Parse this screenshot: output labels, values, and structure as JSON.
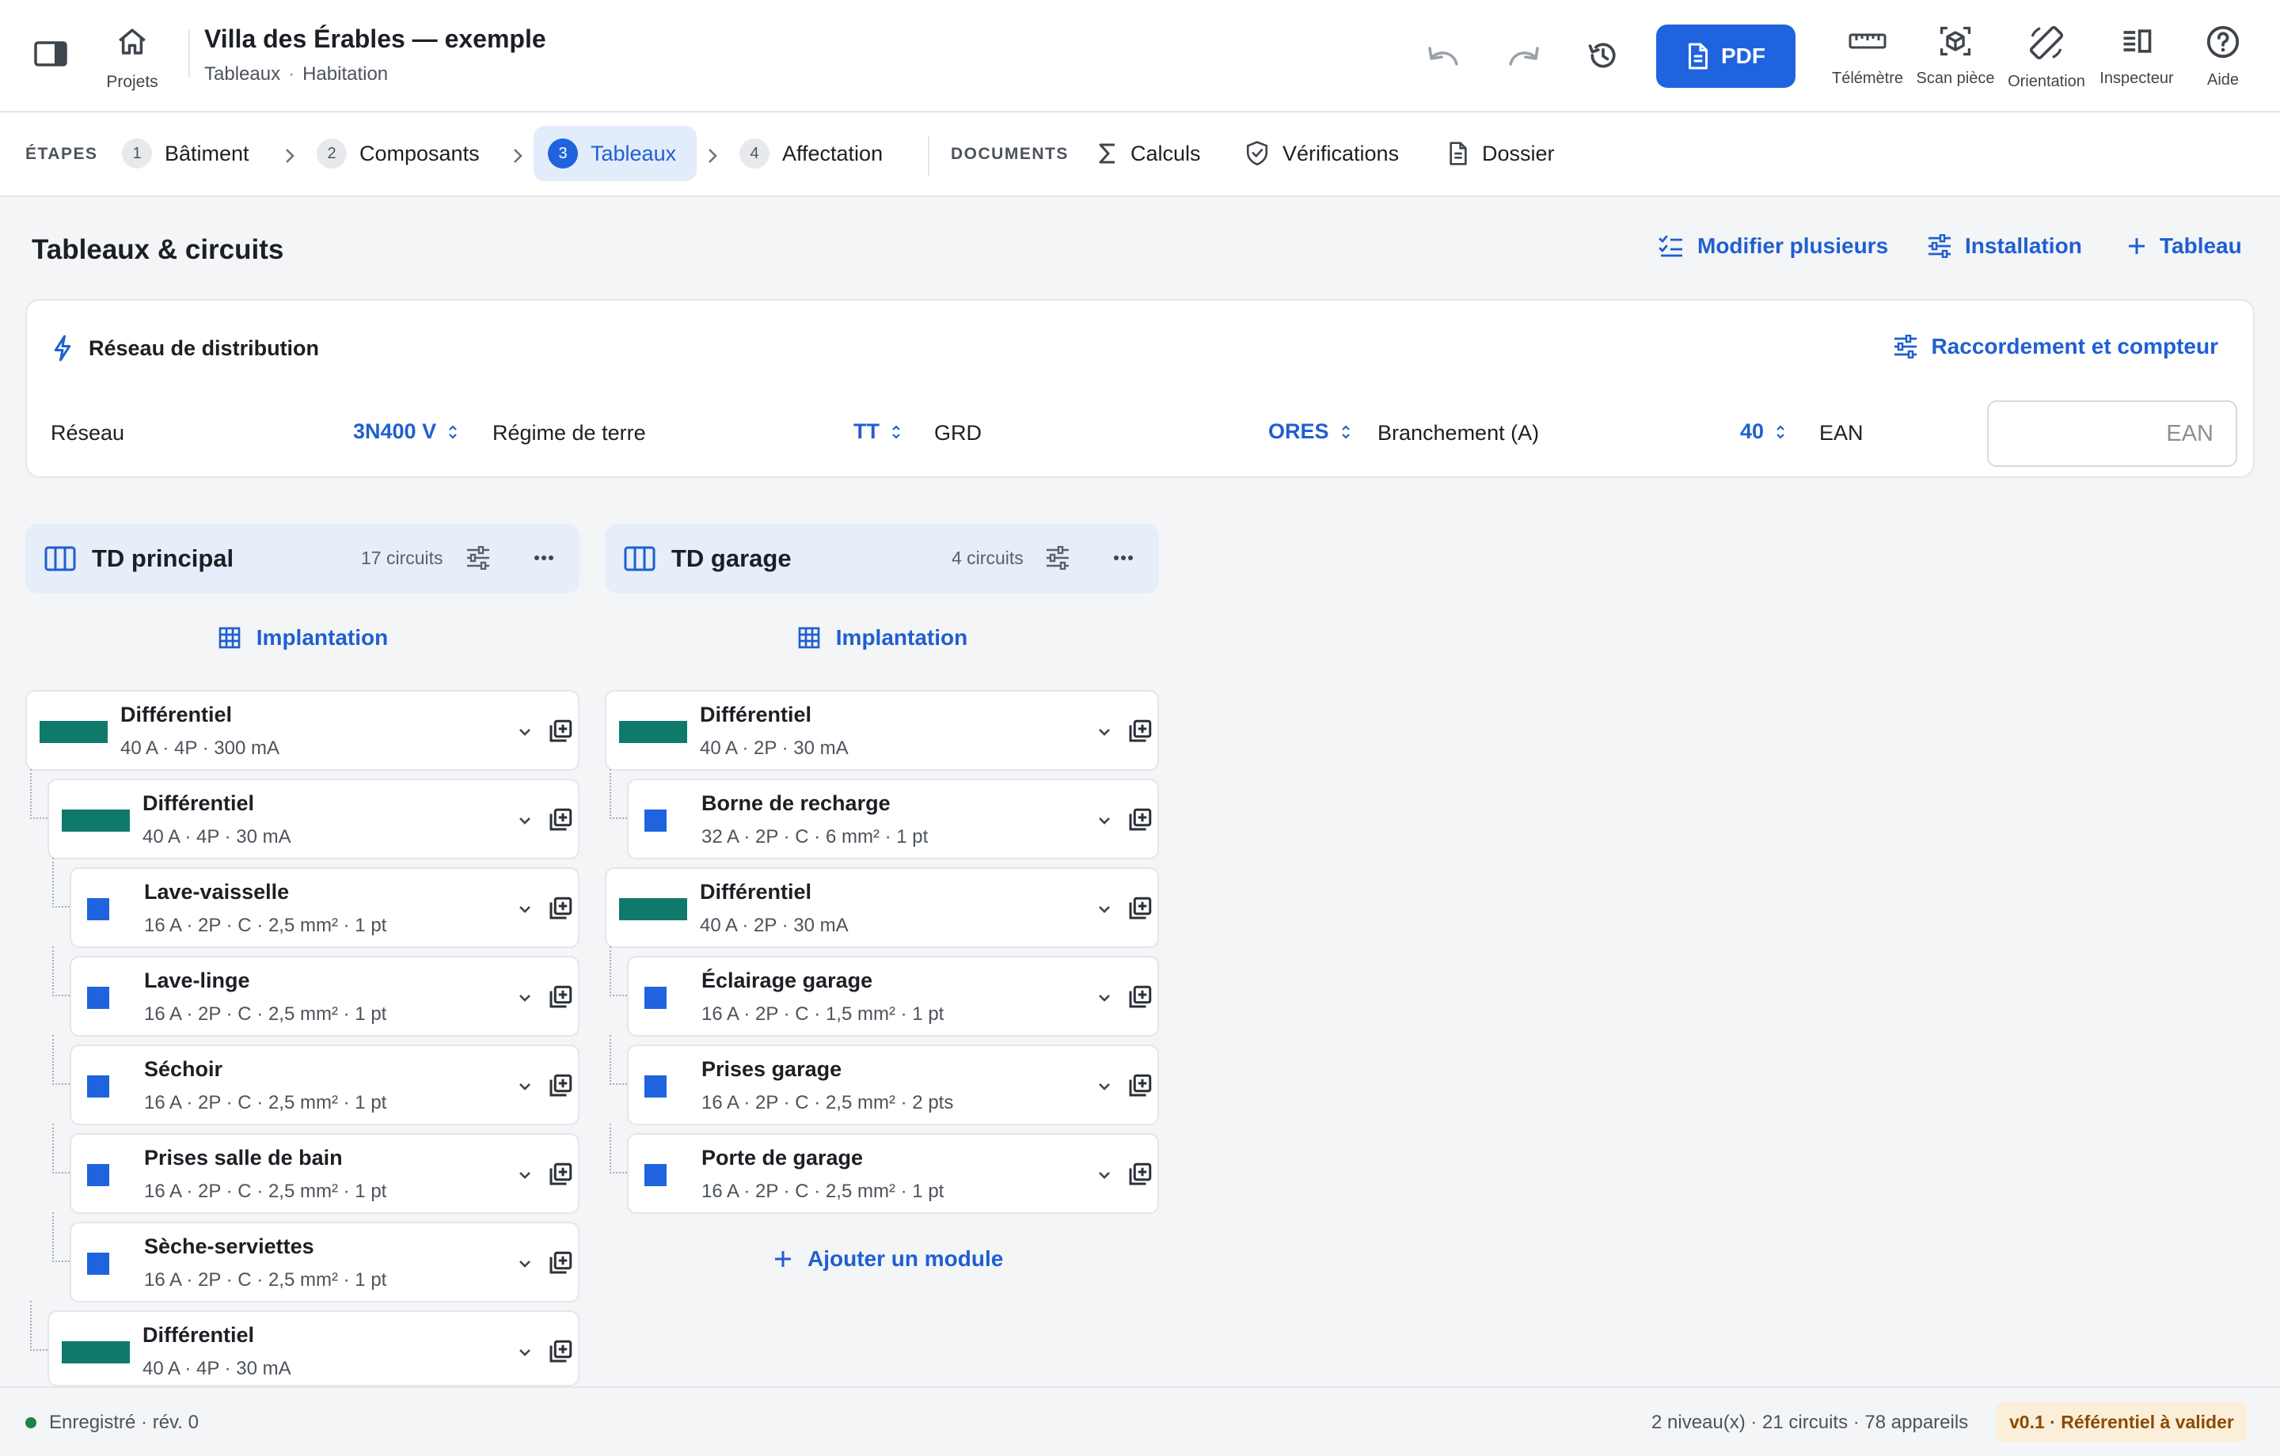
{
  "header": {
    "project_title": "Villa des Érables — exemple",
    "breadcrumb": [
      "Tableaux",
      "Habitation"
    ],
    "home_label": "Projets",
    "pdf_label": "PDF",
    "tools": [
      "Télémètre",
      "Scan pièce",
      "Orientation",
      "Inspecteur",
      "Aide"
    ]
  },
  "steps": {
    "caption": "ÉTAPES",
    "items": [
      {
        "num": "1",
        "label": "Bâtiment"
      },
      {
        "num": "2",
        "label": "Composants"
      },
      {
        "num": "3",
        "label": "Tableaux",
        "active": true
      },
      {
        "num": "4",
        "label": "Affectation"
      }
    ],
    "documents_caption": "DOCUMENTS",
    "documents": [
      "Calculs",
      "Vérifications",
      "Dossier"
    ]
  },
  "page": {
    "title": "Tableaux & circuits",
    "actions": [
      "Modifier plusieurs",
      "Installation",
      "Tableau"
    ]
  },
  "network": {
    "title": "Réseau de distribution",
    "action": "Raccordement et compteur",
    "fields": [
      {
        "label": "Réseau",
        "value": "3N400 V"
      },
      {
        "label": "Régime de terre",
        "value": "TT"
      },
      {
        "label": "GRD",
        "value": "ORES"
      },
      {
        "label": "Branchement (A)",
        "value": "40"
      }
    ],
    "ean_label": "EAN",
    "ean_placeholder": "EAN",
    "ean_value": ""
  },
  "panels": [
    {
      "name": "TD principal",
      "count": "17 circuits",
      "implantation": "Implantation",
      "modules": [
        {
          "name": "Différentiel",
          "spec": "40 A · 4P · 300 mA",
          "kind": "diff",
          "level": 0
        },
        {
          "name": "Différentiel",
          "spec": "40 A · 4P · 30 mA",
          "kind": "diff",
          "level": 1
        },
        {
          "name": "Lave-vaisselle",
          "spec": "16 A · 2P · C · 2,5 mm² · 1 pt",
          "kind": "circuit",
          "level": 2
        },
        {
          "name": "Lave-linge",
          "spec": "16 A · 2P · C · 2,5 mm² · 1 pt",
          "kind": "circuit",
          "level": 2
        },
        {
          "name": "Séchoir",
          "spec": "16 A · 2P · C · 2,5 mm² · 1 pt",
          "kind": "circuit",
          "level": 2
        },
        {
          "name": "Prises salle de bain",
          "spec": "16 A · 2P · C · 2,5 mm² · 1 pt",
          "kind": "circuit",
          "level": 2
        },
        {
          "name": "Sèche-serviettes",
          "spec": "16 A · 2P · C · 2,5 mm² · 1 pt",
          "kind": "circuit",
          "level": 2
        },
        {
          "name": "Différentiel",
          "spec": "40 A · 4P · 30 mA",
          "kind": "diff",
          "level": 1
        }
      ]
    },
    {
      "name": "TD garage",
      "count": "4 circuits",
      "implantation": "Implantation",
      "modules": [
        {
          "name": "Différentiel",
          "spec": "40 A · 2P · 30 mA",
          "kind": "diff",
          "level": 0
        },
        {
          "name": "Borne de recharge",
          "spec": "32 A · 2P · C · 6 mm² · 1 pt",
          "kind": "circuit",
          "level": 1
        },
        {
          "name": "Différentiel",
          "spec": "40 A · 2P · 30 mA",
          "kind": "diff",
          "level": 0
        },
        {
          "name": "Éclairage garage",
          "spec": "16 A · 2P · C · 1,5 mm² · 1 pt",
          "kind": "circuit",
          "level": 1
        },
        {
          "name": "Prises garage",
          "spec": "16 A · 2P · C · 2,5 mm² · 2 pts",
          "kind": "circuit",
          "level": 1
        },
        {
          "name": "Porte de garage",
          "spec": "16 A · 2P · C · 2,5 mm² · 1 pt",
          "kind": "circuit",
          "level": 1
        }
      ],
      "add_module": "Ajouter un module"
    }
  ],
  "status": {
    "saved": "Enregistré · rév. 0",
    "stats": "2 niveau(x) · 21 circuits · 78 appareils",
    "badge": "v0.1 · Référentiel à valider"
  },
  "colors": {
    "accent": "#1f64de",
    "differential": "#0f7a6c",
    "circuit": "#1f64de",
    "status_ok": "#17864a"
  }
}
